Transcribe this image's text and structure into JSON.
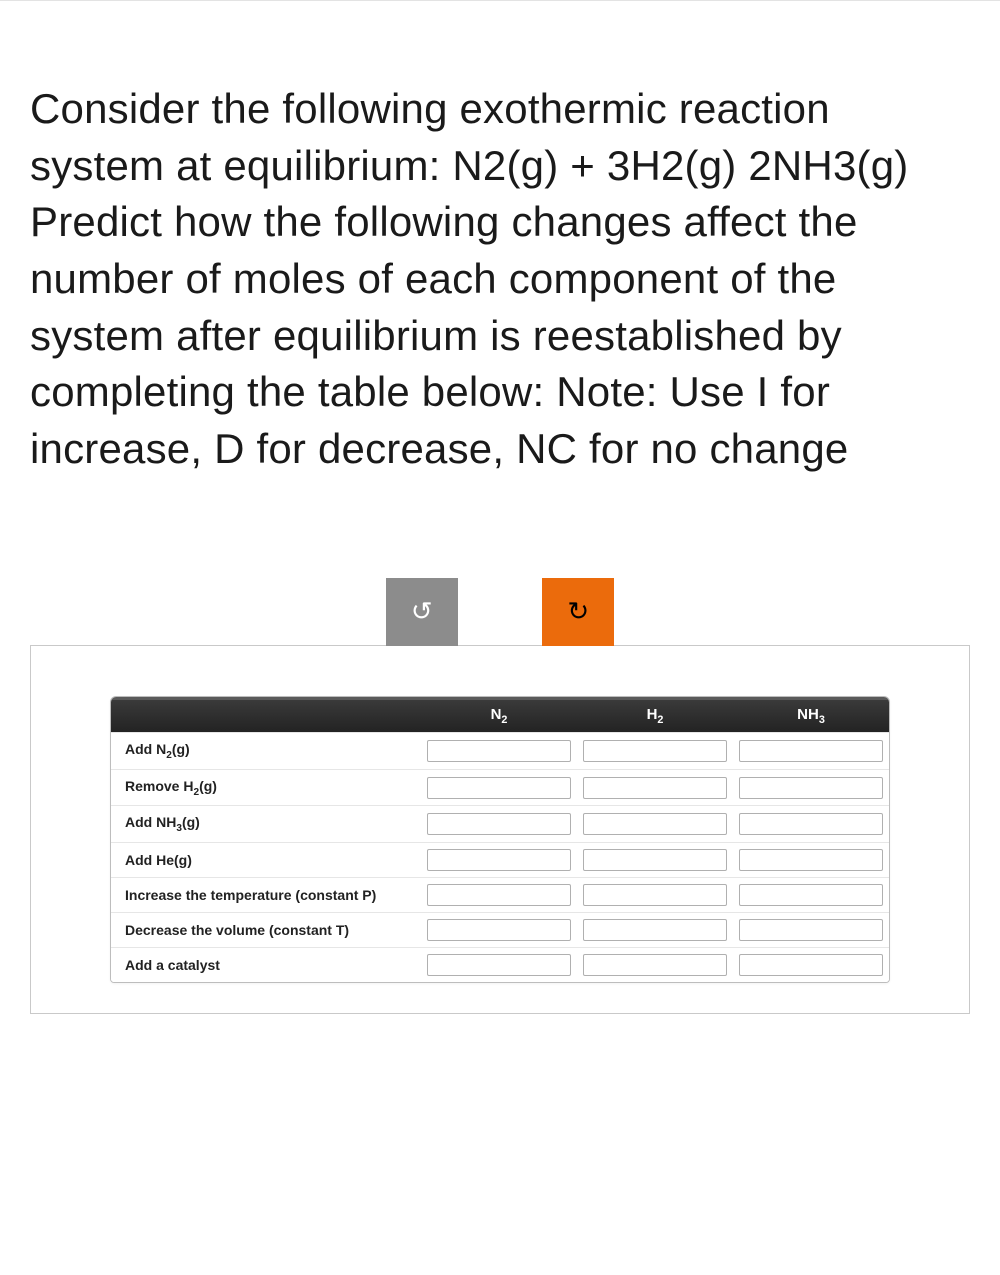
{
  "question": "Consider the following exothermic reaction system at equilibrium: N2(g) + 3H2(g) 2NH3(g) Predict how the following changes affect the number of moles of each component of the system after equilibrium is reestablished by completing the table below: Note: Use I for increase, D for decrease, NC for no change",
  "controls": {
    "undo_glyph": "↺",
    "redo_glyph": "↻"
  },
  "table": {
    "headers": {
      "blank": "",
      "n2_html": "N<sub>2</sub>",
      "h2_html": "H<sub>2</sub>",
      "nh3_html": "NH<sub>3</sub>"
    },
    "rows": [
      {
        "label_html": "Add N<sub>2</sub>(g)",
        "n2": "",
        "h2": "",
        "nh3": ""
      },
      {
        "label_html": "Remove H<sub>2</sub>(g)",
        "n2": "",
        "h2": "",
        "nh3": ""
      },
      {
        "label_html": "Add NH<sub>3</sub>(g)",
        "n2": "",
        "h2": "",
        "nh3": ""
      },
      {
        "label_html": "Add He(g)",
        "n2": "",
        "h2": "",
        "nh3": ""
      },
      {
        "label_html": "Increase the temperature (constant P)",
        "n2": "",
        "h2": "",
        "nh3": ""
      },
      {
        "label_html": "Decrease the volume (constant T)",
        "n2": "",
        "h2": "",
        "nh3": ""
      },
      {
        "label_html": "Add a catalyst",
        "n2": "",
        "h2": "",
        "nh3": ""
      }
    ]
  }
}
